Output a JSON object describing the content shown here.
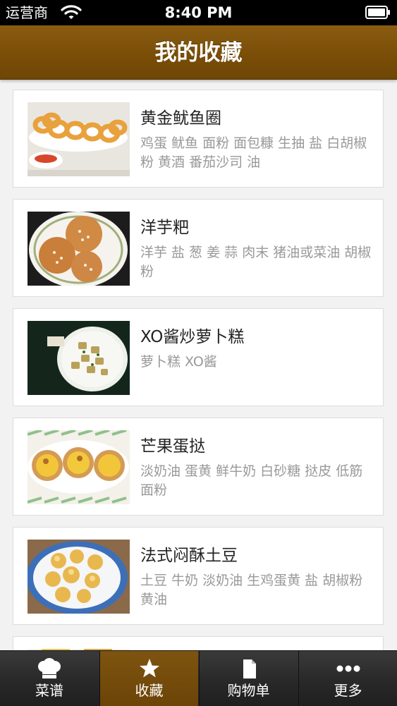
{
  "status_bar": {
    "carrier": "运营商",
    "time": "8:40 PM"
  },
  "nav": {
    "title": "我的收藏"
  },
  "recipes": [
    {
      "name": "黄金鱿鱼圈",
      "ingredients": "鸡蛋 鱿鱼 面粉 面包糠 生抽 盐 白胡椒粉 黄酒 番茄沙司 油"
    },
    {
      "name": "洋芋粑",
      "ingredients": "洋芋 盐 葱 姜 蒜 肉末 猪油或菜油 胡椒粉"
    },
    {
      "name": "XO酱炒萝卜糕",
      "ingredients": "萝卜糕 XO酱"
    },
    {
      "name": "芒果蛋挞",
      "ingredients": "淡奶油 蛋黄 鲜牛奶 白砂糖 挞皮 低筋面粉"
    },
    {
      "name": "法式闷酥土豆",
      "ingredients": "土豆 牛奶 淡奶油 生鸡蛋黄 盐 胡椒粉 黄油"
    }
  ],
  "tabs": [
    {
      "label": "菜谱",
      "icon": "chef-hat-icon"
    },
    {
      "label": "收藏",
      "icon": "star-icon",
      "active": true
    },
    {
      "label": "购物单",
      "icon": "document-icon"
    },
    {
      "label": "更多",
      "icon": "more-dots-icon"
    }
  ],
  "colors": {
    "nav_brown": "#7a4e07",
    "tab_active_brown": "#7f5410",
    "tab_bar_dark": "#2a2a2a"
  }
}
